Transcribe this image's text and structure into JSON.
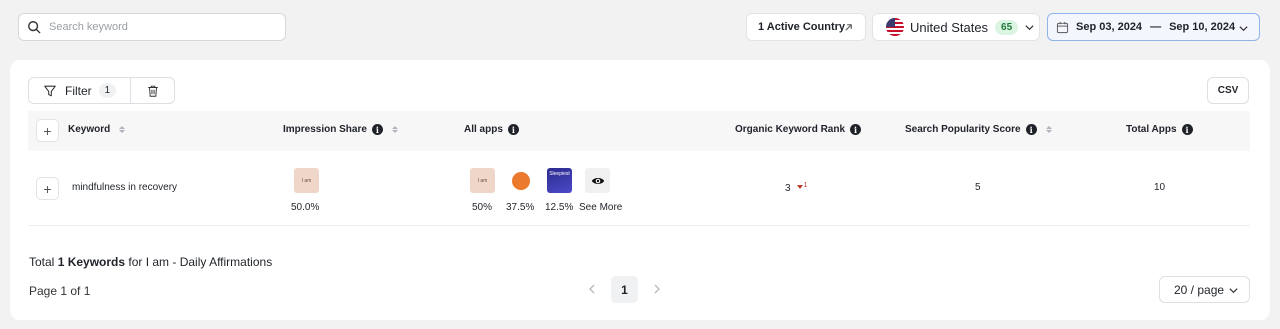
{
  "search": {
    "placeholder": "Search keyword"
  },
  "top": {
    "active_country": "1 Active Country",
    "country_name": "United States",
    "country_count": "65",
    "date_start": "Sep 03, 2024",
    "date_sep": "—",
    "date_end": "Sep 10, 2024"
  },
  "toolbar": {
    "filter_label": "Filter",
    "filter_count": "1",
    "csv_label": "CSV"
  },
  "table": {
    "headers": {
      "keyword": "Keyword",
      "impression_share": "Impression Share",
      "all_apps": "All apps",
      "organic_rank": "Organic Keyword Rank",
      "popularity": "Search Popularity Score",
      "total_apps": "Total Apps"
    },
    "rows": [
      {
        "keyword": "mindfulness in recovery",
        "impression_icon_text": "I am",
        "impression_share": "50.0%",
        "apps": [
          {
            "icon_text": "I am",
            "share": "50%"
          },
          {
            "icon_text": "",
            "share": "37.5%"
          },
          {
            "icon_text": "Sleepiest",
            "share": "12.5%"
          }
        ],
        "see_more": "See More",
        "rank": "3",
        "rank_delta": "1",
        "popularity": "5",
        "total_apps": "10"
      }
    ]
  },
  "footer": {
    "total_prefix": "Total ",
    "total_bold": "1 Keywords",
    "total_suffix": " for I am - Daily Affirmations",
    "page_info": "Page 1 of 1",
    "current_page": "1",
    "per_page": "20 / page"
  },
  "colors": {
    "accent_border": "#8fb4e8",
    "badge_green": "#dcf5e3",
    "rank_down": "#c0392b"
  }
}
